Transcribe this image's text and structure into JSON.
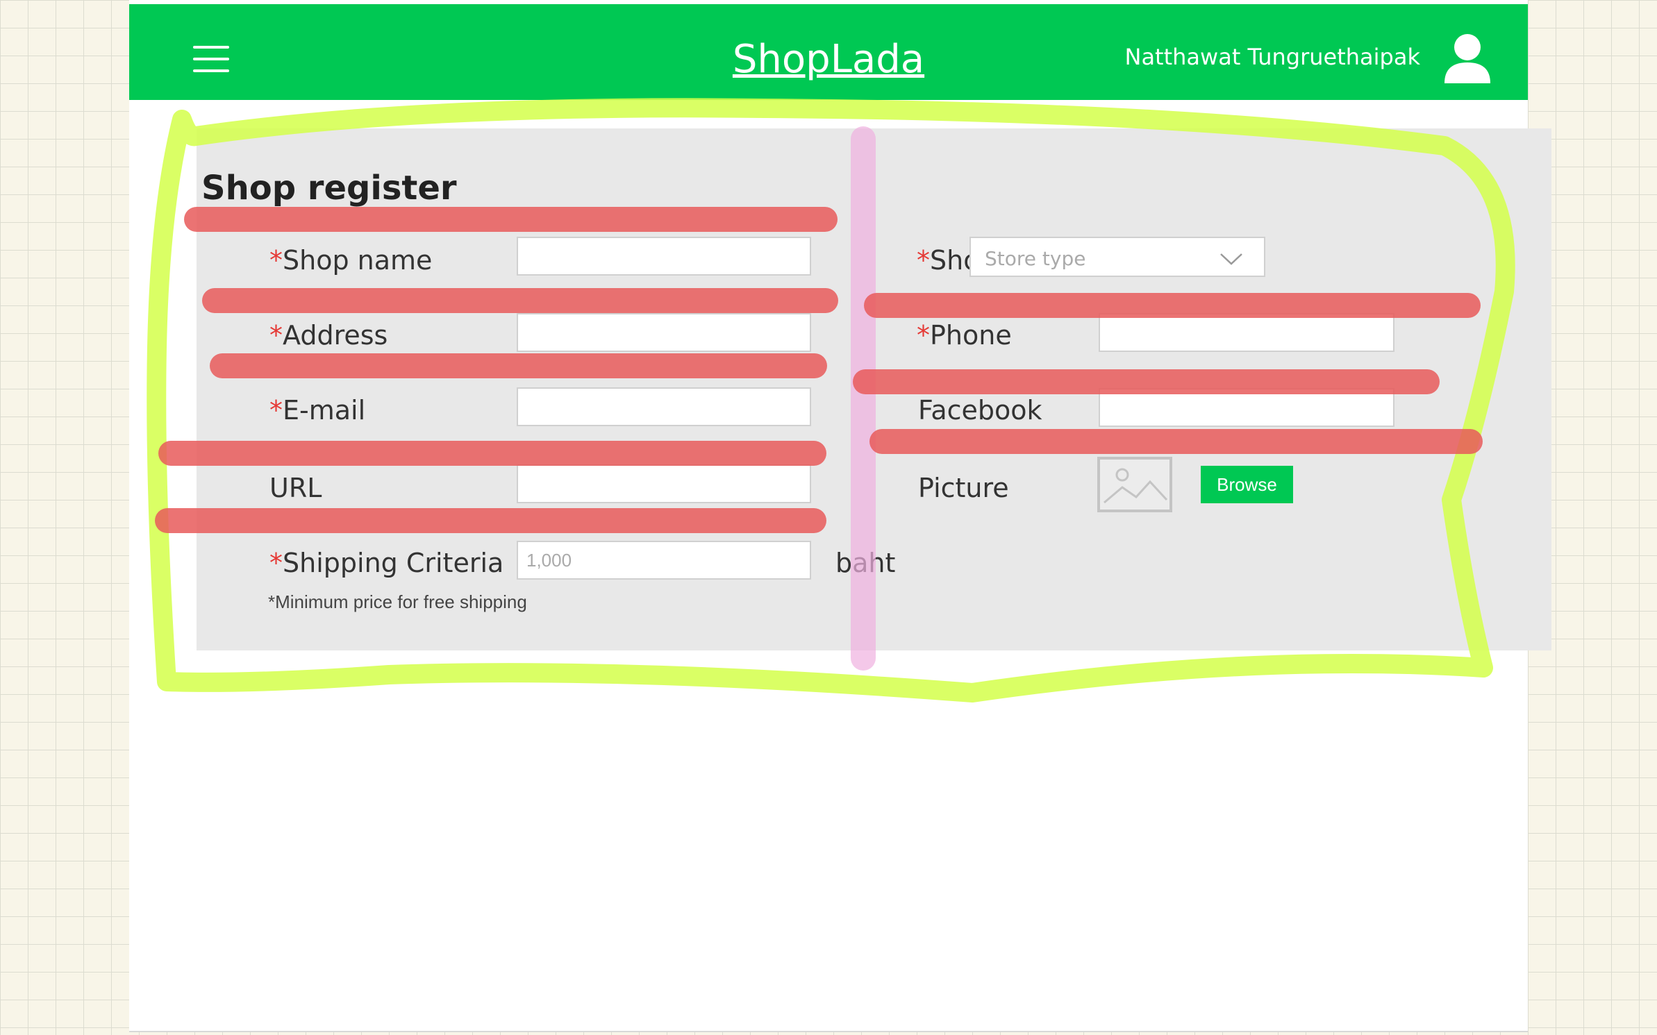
{
  "header": {
    "brand": "ShopLada",
    "user_name": "Natthawat Tungruethaipak",
    "menu_icon": "hamburger-menu-icon",
    "user_icon": "user-icon"
  },
  "form": {
    "title": "Shop register",
    "required_mark": "*",
    "left_fields": {
      "shop_name": {
        "label": "Shop name",
        "value": ""
      },
      "address": {
        "label": "Address",
        "value": ""
      },
      "email": {
        "label": "E-mail",
        "value": ""
      },
      "url": {
        "label": "URL",
        "value": ""
      },
      "shipping": {
        "label": "Shipping Criteria",
        "placeholder": "1,000",
        "value": "",
        "unit": "baht"
      }
    },
    "shipping_note": "*Minimum price for free shipping",
    "right_fields": {
      "shop_type": {
        "label": "Shop type",
        "placeholder": "Store type"
      },
      "phone": {
        "label": "Phone",
        "value": ""
      },
      "facebook": {
        "label": "Facebook",
        "value": ""
      },
      "picture": {
        "label": "Picture",
        "button_label": "Browse",
        "icon": "image-placeholder-icon"
      }
    }
  },
  "colors": {
    "brand_green": "#00c853",
    "required_red": "#e53935",
    "annotation_yellow": "#d4ff4a",
    "annotation_red": "#e85a5a",
    "annotation_pink": "#f0b0e0"
  }
}
